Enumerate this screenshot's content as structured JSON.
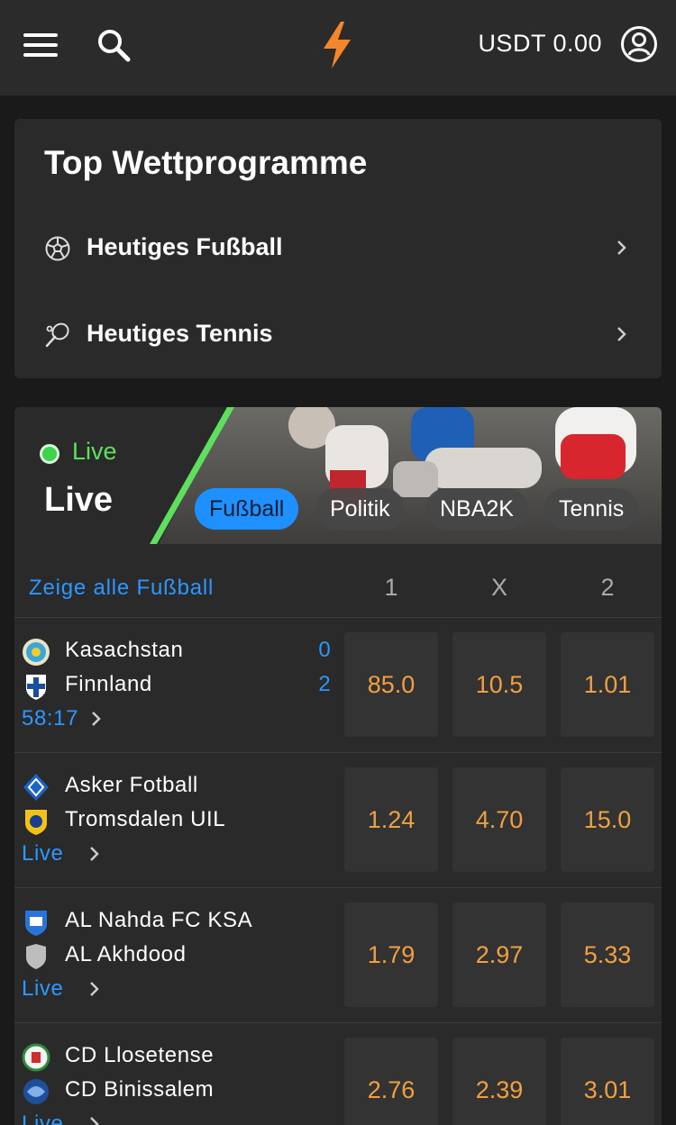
{
  "header": {
    "balance": "USDT 0.00",
    "icons": [
      "menu-icon",
      "search-icon",
      "lightning-logo-icon",
      "user-icon"
    ],
    "brand_color": "#f5862b"
  },
  "top_programs": {
    "title": "Top Wettprogramme",
    "items": [
      {
        "label": "Heutiges Fußball",
        "icon": "soccer-ball-icon"
      },
      {
        "label": "Heutiges Tennis",
        "icon": "tennis-racket-icon"
      }
    ]
  },
  "live": {
    "badge": "Live",
    "title": "Live",
    "tabs": [
      {
        "label": "Fußball",
        "active": true
      },
      {
        "label": "Politik",
        "active": false
      },
      {
        "label": "NBA2K",
        "active": false
      },
      {
        "label": "Tennis",
        "active": false
      }
    ],
    "show_all": "Zeige alle Fußball",
    "columns": [
      "1",
      "X",
      "2"
    ],
    "matches": [
      {
        "home": "Kasachstan",
        "away": "Finnland",
        "home_score": "0",
        "away_score": "2",
        "status": "58:17",
        "odds": [
          "85.0",
          "10.5",
          "1.01"
        ]
      },
      {
        "home": "Asker Fotball",
        "away": "Tromsdalen UIL",
        "home_score": "",
        "away_score": "",
        "status": "Live",
        "odds": [
          "1.24",
          "4.70",
          "15.0"
        ]
      },
      {
        "home": "AL Nahda FC KSA",
        "away": "AL Akhdood",
        "home_score": "",
        "away_score": "",
        "status": "Live",
        "odds": [
          "1.79",
          "2.97",
          "5.33"
        ]
      },
      {
        "home": "CD Llosetense",
        "away": "CD Binissalem",
        "home_score": "",
        "away_score": "",
        "status": "Live",
        "odds": [
          "2.76",
          "2.39",
          "3.01"
        ]
      }
    ],
    "colors": {
      "live_green": "#3dd34a",
      "link_blue": "#2c97ff",
      "odds_orange": "#f0a040"
    }
  }
}
